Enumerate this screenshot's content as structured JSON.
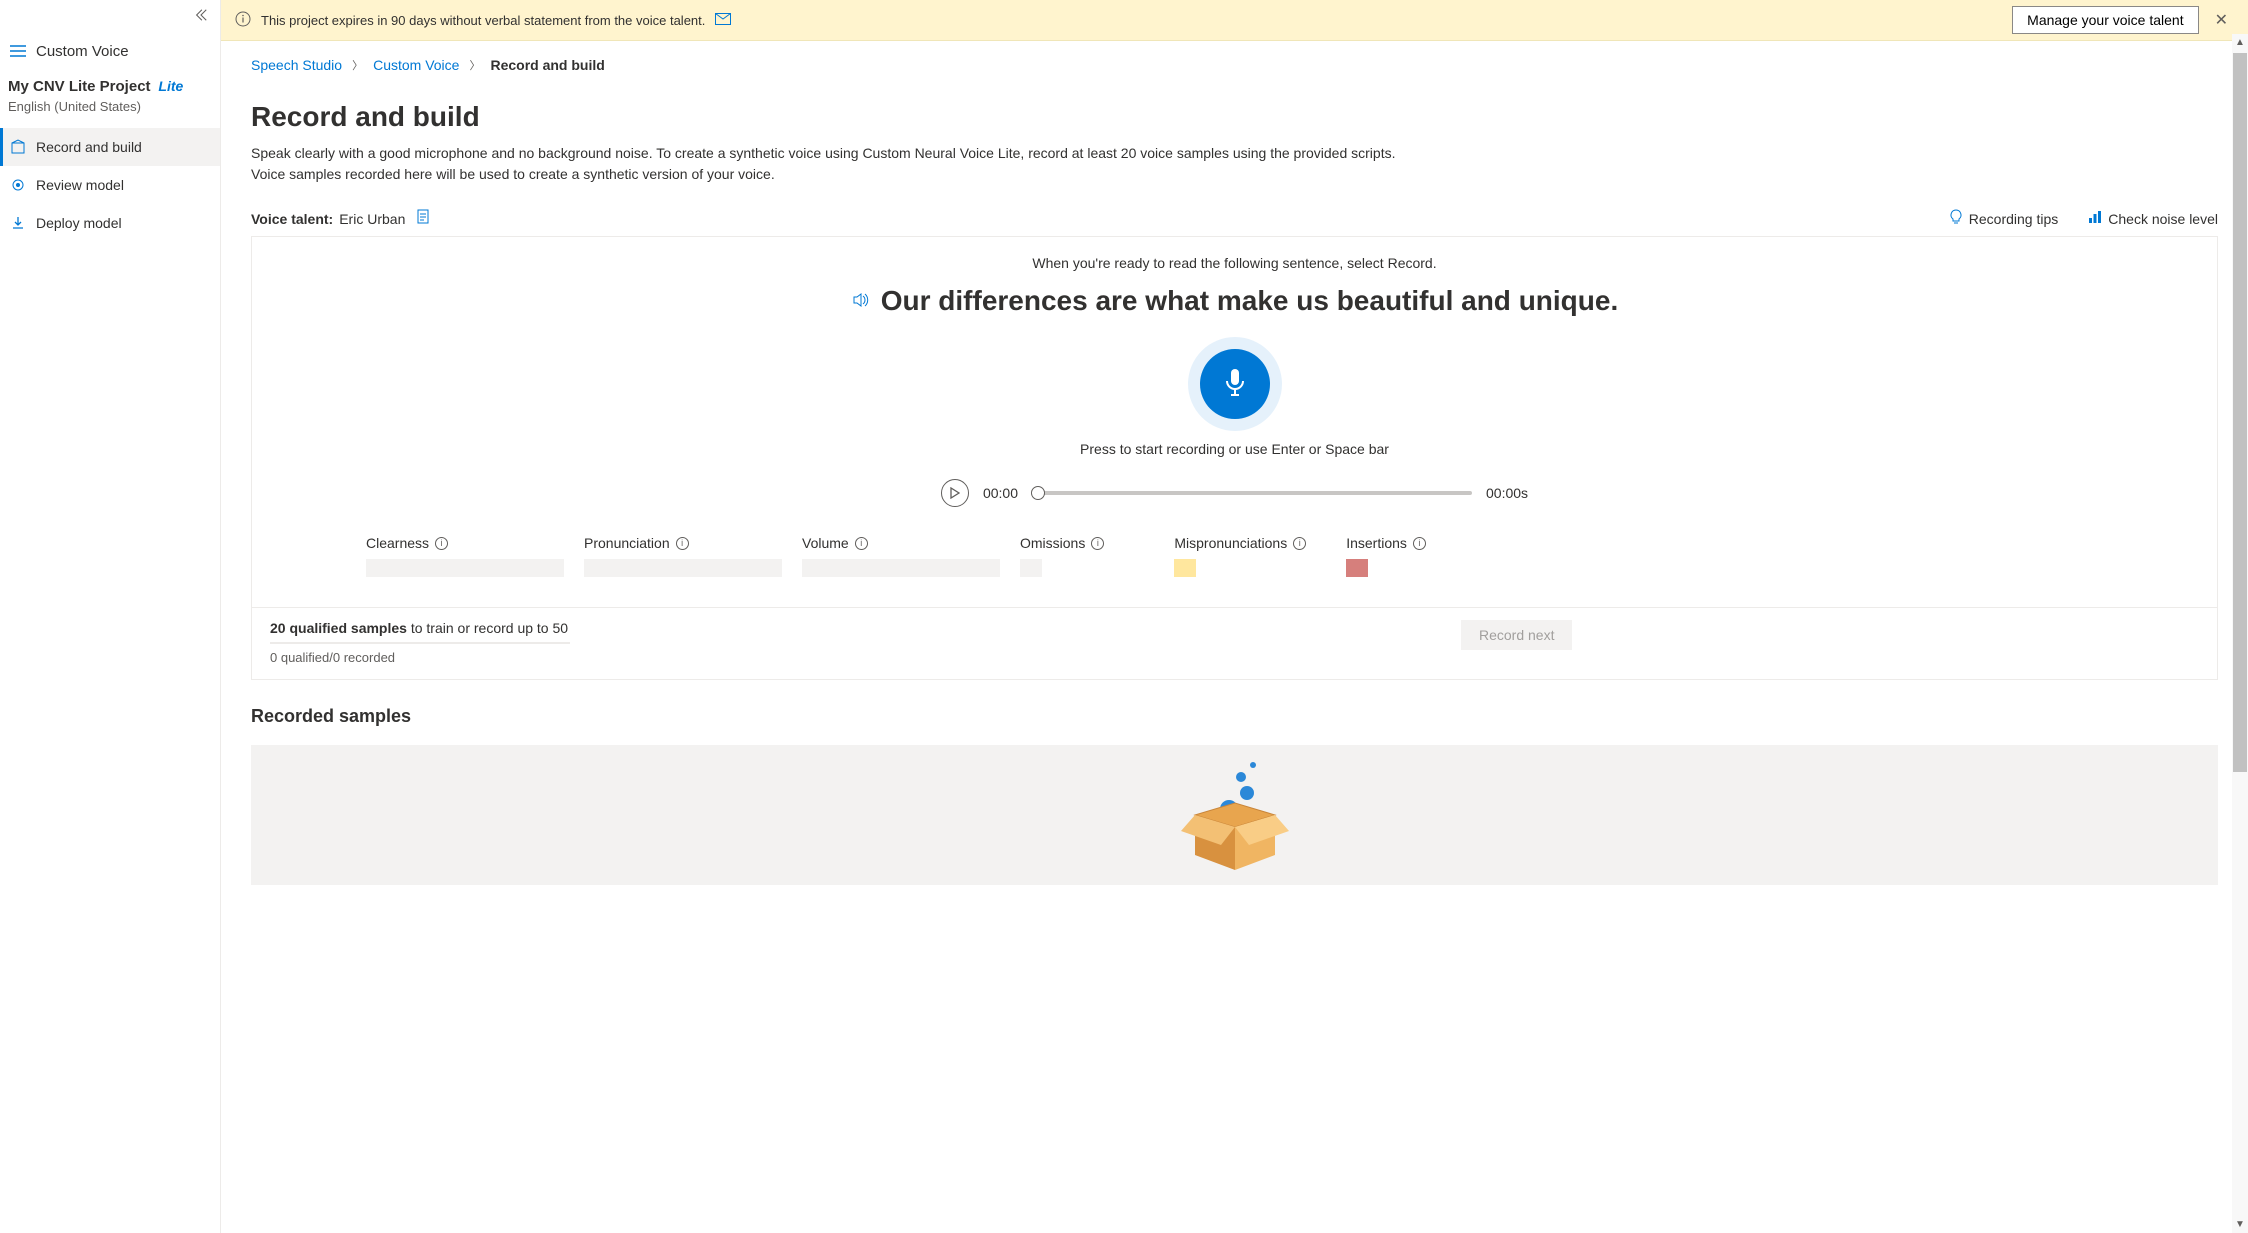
{
  "sidebar": {
    "app_title": "Custom Voice",
    "project_name": "My CNV Lite Project",
    "lite_badge": "Lite",
    "project_lang": "English (United States)",
    "nav": [
      {
        "label": "Record and build",
        "icon": "box-icon",
        "active": true
      },
      {
        "label": "Review model",
        "icon": "review-icon",
        "active": false
      },
      {
        "label": "Deploy model",
        "icon": "deploy-icon",
        "active": false
      }
    ]
  },
  "notice": {
    "text": "This project expires in 90 days without verbal statement from the voice talent.",
    "manage_label": "Manage your voice talent"
  },
  "breadcrumb": {
    "items": [
      {
        "label": "Speech Studio",
        "link": true
      },
      {
        "label": "Custom Voice",
        "link": true
      },
      {
        "label": "Record and build",
        "link": false
      }
    ]
  },
  "page": {
    "title": "Record and build",
    "description": "Speak clearly with a good microphone and no background noise. To create a synthetic voice using Custom Neural Voice Lite, record at least 20 voice samples using the provided scripts. Voice samples recorded here will be used to create a synthetic version of your voice."
  },
  "talent": {
    "label": "Voice talent",
    "name": "Eric Urban"
  },
  "tips": {
    "recording": "Recording tips",
    "noise": "Check noise level"
  },
  "recorder": {
    "ready_text": "When you're ready to read the following sentence, select Record.",
    "sentence": "Our differences are what make us beautiful and unique.",
    "hint": "Press to start recording or use Enter or Space bar",
    "time_current": "00:00",
    "time_total": "00:00s"
  },
  "metrics": {
    "clearness": "Clearness",
    "pronunciation": "Pronunciation",
    "volume": "Volume",
    "omissions": "Omissions",
    "mispronunciations": "Mispronunciations",
    "insertions": "Insertions"
  },
  "samples": {
    "required_bold": "20 qualified samples",
    "required_rest": " to train or record up to 50",
    "status": "0 qualified/0 recorded",
    "record_next": "Record next"
  },
  "recorded_section": {
    "title": "Recorded samples"
  }
}
